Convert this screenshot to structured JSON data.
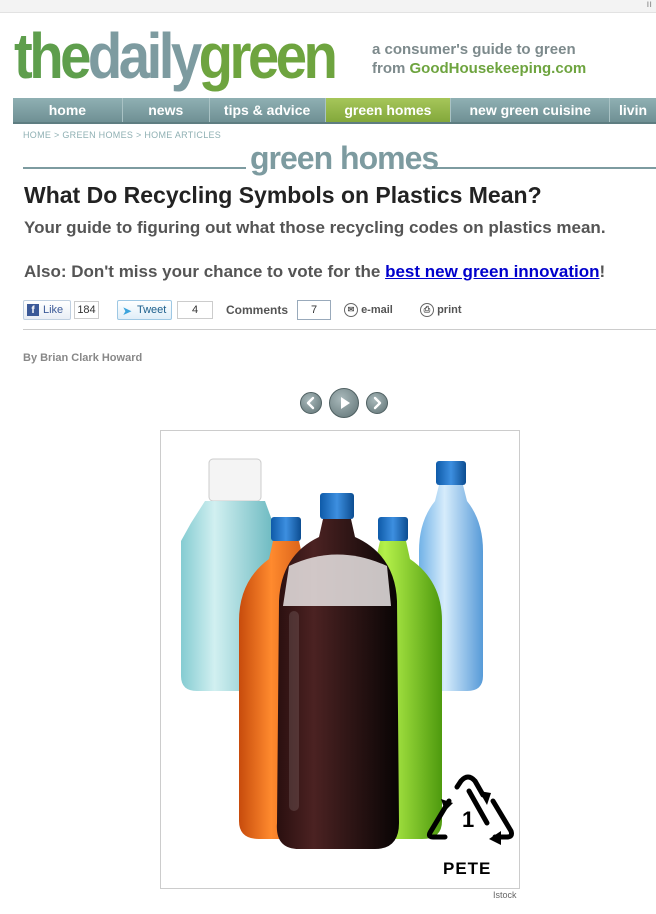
{
  "topbar": {
    "glyph": "ıı"
  },
  "logo": {
    "the": "the",
    "daily": "daily",
    "green": "green"
  },
  "tagline": {
    "line1": "a consumer's guide to green",
    "line2_prefix": "from ",
    "line2_brand": "GoodHousekeeping.com"
  },
  "nav": {
    "items": [
      "home",
      "news",
      "tips & advice",
      "green homes",
      "new green cuisine",
      "livin"
    ],
    "active": "green homes"
  },
  "breadcrumb": {
    "home": "HOME",
    "sep": " > ",
    "section": "GREEN HOMES",
    "sub": "HOME ARTICLES"
  },
  "section_title": "green homes",
  "article": {
    "title": "What Do Recycling Symbols on Plastics Mean?",
    "dek": "Your guide to figuring out what those recycling codes on plastics mean.",
    "also_prefix": "Also: Don't miss your chance to vote for the ",
    "also_link": "best new green innovation",
    "also_suffix": "!",
    "byline": "By Brian Clark Howard"
  },
  "social": {
    "like_label": "Like",
    "like_count": "184",
    "tweet_label": "Tweet",
    "tweet_count": "4",
    "comments_label": "Comments",
    "comments_count": "7",
    "email_label": "e-mail",
    "print_label": "print"
  },
  "slideshow": {
    "prev_icon": "chevron-left-icon",
    "play_icon": "play-icon",
    "next_icon": "chevron-right-icon",
    "recycle_number": "1",
    "recycle_code": "PETE",
    "credit": "Istock"
  },
  "colors": {
    "brand_green": "#6ea43f",
    "brand_teal": "#7d9ba0",
    "link": "#0000cc",
    "nav_active": "#8fb24a"
  }
}
